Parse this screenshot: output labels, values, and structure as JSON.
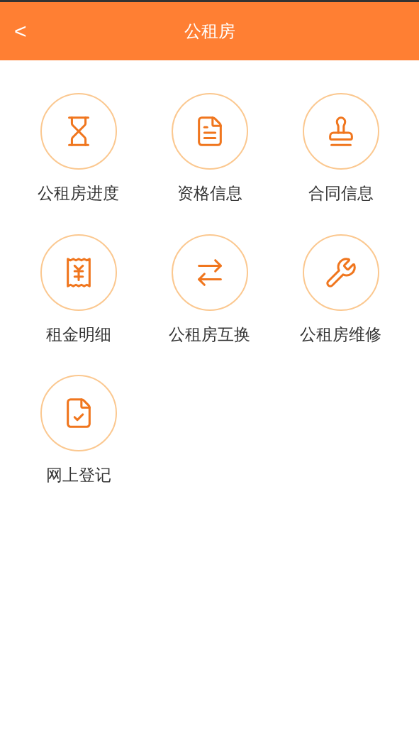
{
  "header": {
    "back": "<",
    "title": "公租房"
  },
  "items": [
    {
      "label": "公租房进度",
      "kind": "hourglass"
    },
    {
      "label": "资格信息",
      "kind": "document"
    },
    {
      "label": "合同信息",
      "kind": "stamp"
    },
    {
      "label": "租金明细",
      "kind": "receipt"
    },
    {
      "label": "公租房互换",
      "kind": "exchange"
    },
    {
      "label": "公租房维修",
      "kind": "tools"
    },
    {
      "label": "网上登记",
      "kind": "register"
    }
  ]
}
